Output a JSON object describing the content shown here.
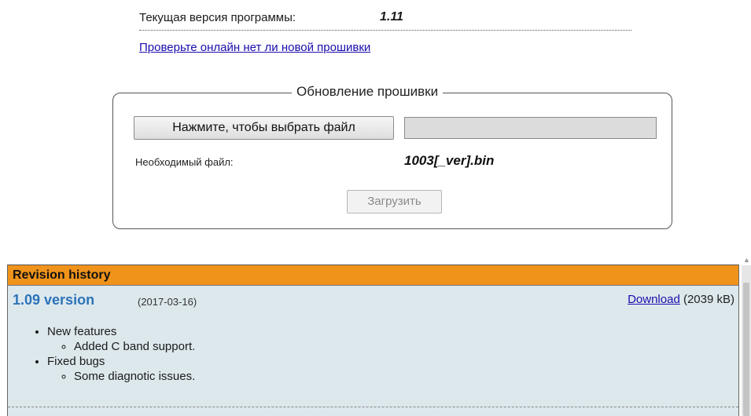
{
  "firmware": {
    "current_version_label": "Текущая версия программы:",
    "current_version_value": "1.11",
    "check_online_link": "Проверьте онлайн нет ли новой прошивки",
    "update_section_title": "Обновление прошивки",
    "choose_file_button": "Нажмите, чтобы выбрать файл",
    "selected_file": "",
    "required_file_label": "Необходимый файл:",
    "required_file_value": "1003[_ver].bin",
    "upload_button": "Загрузить"
  },
  "revision_history": {
    "title": "Revision history",
    "release": {
      "version": "1.09 version",
      "date": "(2017-03-16)",
      "download_label": "Download",
      "download_size": " (2039 kB)",
      "changes": [
        {
          "heading": "New features",
          "items": [
            "Added C band support."
          ]
        },
        {
          "heading": "Fixed bugs",
          "items": [
            "Some diagnotic issues."
          ]
        }
      ]
    }
  },
  "colors": {
    "header_accent": "#f0931a",
    "history_background": "#dde8ed",
    "version_link": "#2b73b8",
    "link": "#1a0dab"
  }
}
